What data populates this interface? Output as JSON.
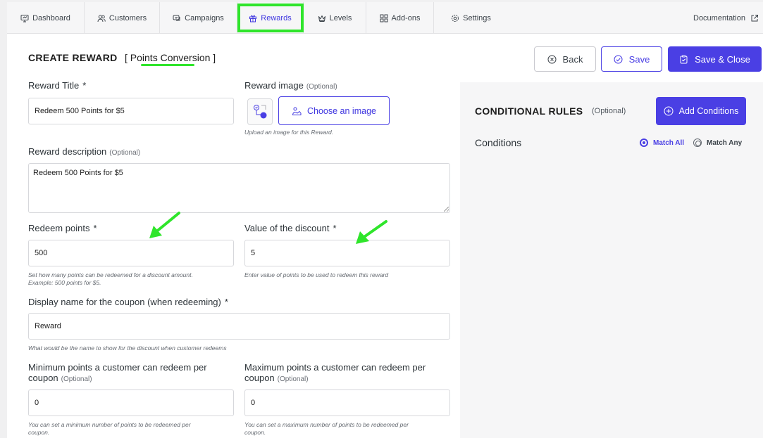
{
  "nav": {
    "tabs": [
      {
        "label": "Dashboard",
        "icon": "monitor-icon"
      },
      {
        "label": "Customers",
        "icon": "users-icon"
      },
      {
        "label": "Campaigns",
        "icon": "chat-icon"
      },
      {
        "label": "Rewards",
        "icon": "gift-icon"
      },
      {
        "label": "Levels",
        "icon": "crown-icon"
      },
      {
        "label": "Add-ons",
        "icon": "grid-icon"
      },
      {
        "label": "Settings",
        "icon": "gear-icon"
      }
    ],
    "documentation": "Documentation"
  },
  "header": {
    "title": "CREATE REWARD",
    "subtitle": "[ Points Conversion ]",
    "back_label": "Back",
    "save_label": "Save",
    "save_close_label": "Save & Close"
  },
  "form": {
    "reward_title": {
      "label": "Reward Title",
      "required": "*",
      "value": "Redeem 500 Points for $5"
    },
    "reward_image": {
      "label": "Reward image",
      "optional": "(Optional)",
      "button": "Choose an image",
      "hint": "Upload an image for this Reward."
    },
    "reward_description": {
      "label": "Reward description",
      "optional": "(Optional)",
      "value": "Redeem 500 Points for $5"
    },
    "redeem_points": {
      "label": "Redeem points",
      "required": "*",
      "value": "500",
      "hint_1": "Set how many points can be redeemed for a discount amount.",
      "hint_2": "Example: 500 points for $5."
    },
    "discount_value": {
      "label": "Value of the discount",
      "required": "*",
      "value": "5",
      "hint": "Enter value of points to be used to redeem this reward"
    },
    "coupon_name": {
      "label": "Display name for the coupon (when redeeming)",
      "required": "*",
      "value": "Reward",
      "hint": "What would be the name to show for the discount when customer redeems"
    },
    "min_points": {
      "label_1": "Minimum points a customer can redeem per",
      "label_2": "coupon",
      "optional": "(Optional)",
      "value": "0",
      "hint_1": "You can set a minimum number of points to be redeemed per",
      "hint_2": "coupon."
    },
    "max_points": {
      "label_1": "Maximum points a customer can redeem per",
      "label_2": "coupon",
      "optional": "(Optional)",
      "value": "0",
      "hint_1": "You can set a maximum number of points to be redeemed per",
      "hint_2": "coupon."
    }
  },
  "rules": {
    "title": "CONDITIONAL RULES",
    "optional": "(Optional)",
    "add_label": "Add Conditions",
    "conditions_label": "Conditions",
    "match_all": "Match All",
    "match_any": "Match Any",
    "selected": "match_all"
  },
  "colors": {
    "accent": "#4a3fe4",
    "annotation": "#2fe52b"
  }
}
